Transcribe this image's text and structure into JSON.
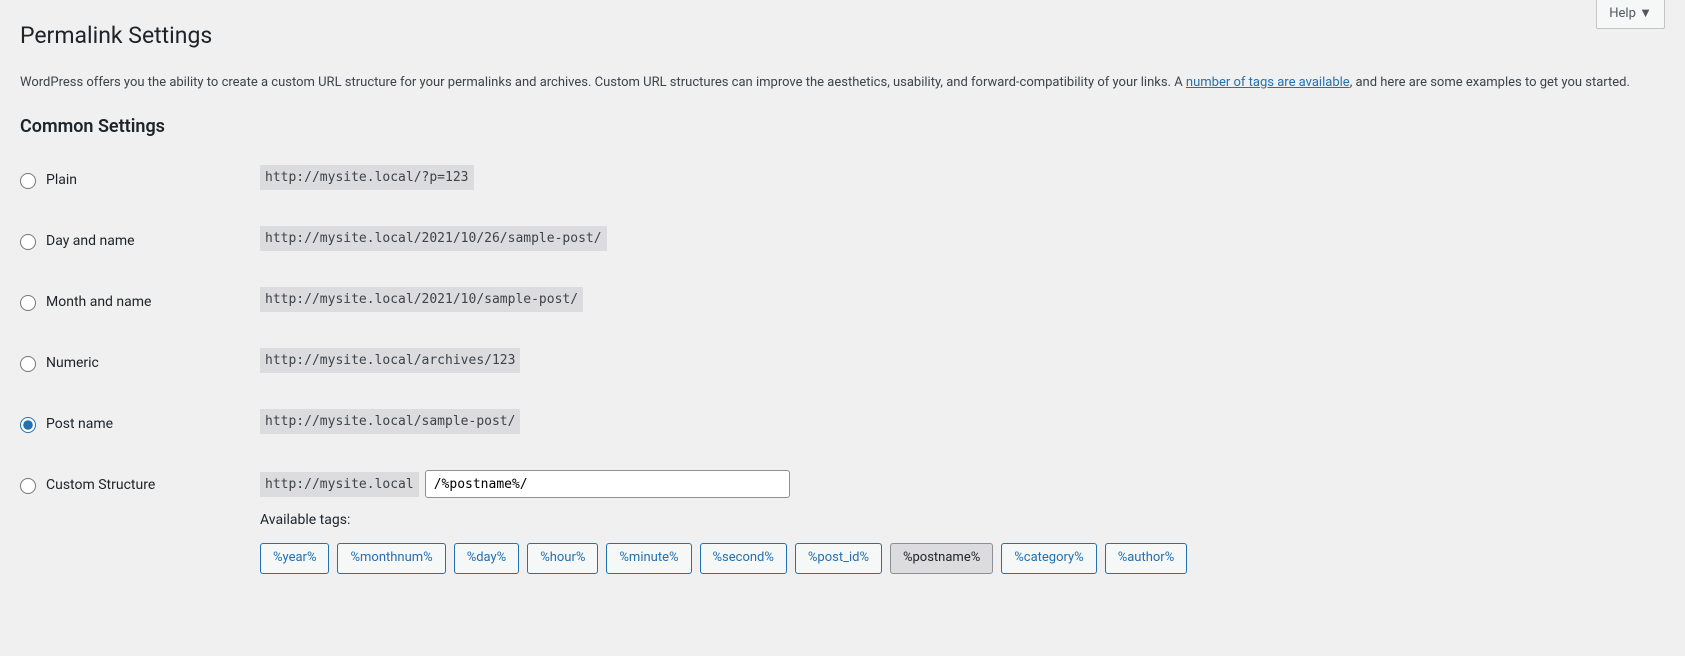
{
  "help_label": "Help ▼",
  "page_title": "Permalink Settings",
  "intro_before_link": "WordPress offers you the ability to create a custom URL structure for your permalinks and archives. Custom URL structures can improve the aesthetics, usability, and forward-compatibility of your links. A ",
  "intro_link": "number of tags are available",
  "intro_after_link": ", and here are some examples to get you started.",
  "common_heading": "Common Settings",
  "options": {
    "plain": {
      "label": "Plain",
      "example": "http://mysite.local/?p=123"
    },
    "day": {
      "label": "Day and name",
      "example": "http://mysite.local/2021/10/26/sample-post/"
    },
    "month": {
      "label": "Month and name",
      "example": "http://mysite.local/2021/10/sample-post/"
    },
    "numeric": {
      "label": "Numeric",
      "example": "http://mysite.local/archives/123"
    },
    "postname": {
      "label": "Post name",
      "example": "http://mysite.local/sample-post/"
    },
    "custom": {
      "label": "Custom Structure",
      "base": "http://mysite.local",
      "value": "/%postname%/"
    }
  },
  "selected": "postname",
  "available_tags_label": "Available tags:",
  "tags": [
    "%year%",
    "%monthnum%",
    "%day%",
    "%hour%",
    "%minute%",
    "%second%",
    "%post_id%",
    "%postname%",
    "%category%",
    "%author%"
  ],
  "active_tag": "%postname%"
}
